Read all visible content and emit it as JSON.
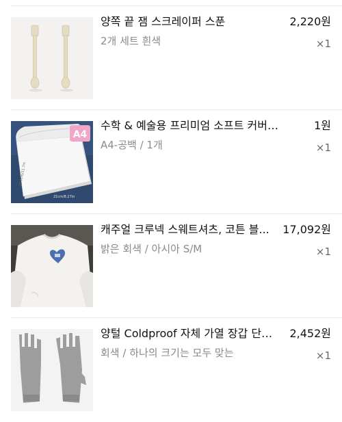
{
  "items": [
    {
      "title": "양쪽 끝 잼 스크레이퍼 스푼",
      "price": "2,220원",
      "variant": "2개 세트 흰색",
      "qty": "×1",
      "thumb_icon": "spoon-scraper-image"
    },
    {
      "title": "수학 & 예술용 프리미엄 소프트 커버 노트 ...",
      "price": "1원",
      "variant": "A4-공백 / 1개",
      "qty": "×1",
      "thumb_icon": "notebook-image",
      "thumb_text": {
        "badge": "A4",
        "dim1": "29.7cm/11.7in",
        "dim2": "21cm/8.27in"
      }
    },
    {
      "title": "캐주얼 크루넥 스웨트셔츠, 코튼 블...",
      "price": "17,092원",
      "variant": "밝은 회색 / 아시아 S/M",
      "qty": "×1",
      "thumb_icon": "sweatshirt-image"
    },
    {
      "title": "양털 Coldproof 자체 가열 장갑 단색...",
      "price": "2,452원",
      "variant": "회색 / 하나의 크기는 모두 맞는",
      "qty": "×1",
      "thumb_icon": "gloves-image"
    }
  ]
}
